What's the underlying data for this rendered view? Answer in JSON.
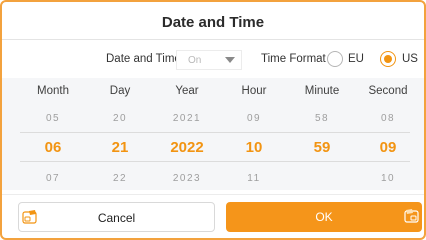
{
  "dialog": {
    "title": "Date and Time"
  },
  "settings": {
    "date_time_label": "Date and Time",
    "date_time_value": "On",
    "time_format_label": "Time Format",
    "format_options": [
      "EU",
      "US"
    ],
    "selected_format": "US"
  },
  "picker": {
    "columns": [
      {
        "header": "Month",
        "prev": "05",
        "selected": "06",
        "next": "07"
      },
      {
        "header": "Day",
        "prev": "20",
        "selected": "21",
        "next": "22"
      },
      {
        "header": "Year",
        "prev": "2021",
        "selected": "2022",
        "next": "2023"
      },
      {
        "header": "Hour",
        "prev": "09",
        "selected": "10",
        "next": "11"
      },
      {
        "header": "Minute",
        "prev": "58",
        "selected": "59",
        "next": ""
      },
      {
        "header": "Second",
        "prev": "08",
        "selected": "09",
        "next": "10"
      }
    ]
  },
  "buttons": {
    "cancel_label": "Cancel",
    "ok_label": "OK",
    "cancel_icon": "keyboard-shortcut-icon",
    "ok_icon": "keyboard-shortcut-icon"
  },
  "colors": {
    "accent": "#f29412",
    "border": "#f3a23d",
    "picker_bg": "#f5f6f8"
  }
}
